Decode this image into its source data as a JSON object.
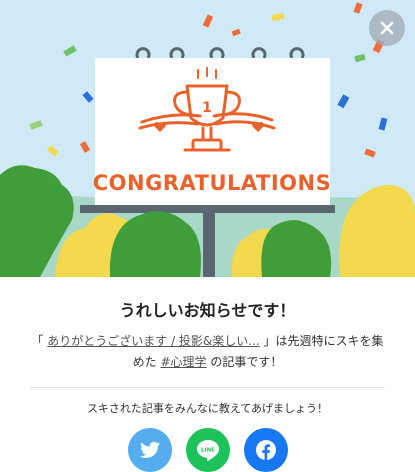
{
  "hero": {
    "billboard_text": "CONGRATULATIONS",
    "trophy_rank": "1",
    "colors": {
      "sky": "#cfe9f6",
      "billboard_text": "#e8632c",
      "tree_green": "#3f9d3a",
      "tree_yellow": "#f2d94e"
    }
  },
  "close_button": {
    "icon": "close-icon"
  },
  "dialog": {
    "title": "うれしいお知らせです！",
    "message": {
      "quote_open": "「 ",
      "article_link": "ありがとうございます / 投影&楽しい...",
      "quote_close": " 」は先週特にスキを集めた ",
      "hashtag_link": "#心理学",
      "suffix": " の記事です！"
    },
    "share_prompt": "スキされた記事をみんなに教えてあげましょう！",
    "share_buttons": [
      {
        "name": "twitter",
        "icon": "twitter-icon",
        "color": "#55acee"
      },
      {
        "name": "line",
        "icon": "line-icon",
        "label": "LINE",
        "color": "#1dc35a"
      },
      {
        "name": "facebook",
        "icon": "facebook-icon",
        "color": "#1877f2"
      }
    ]
  }
}
